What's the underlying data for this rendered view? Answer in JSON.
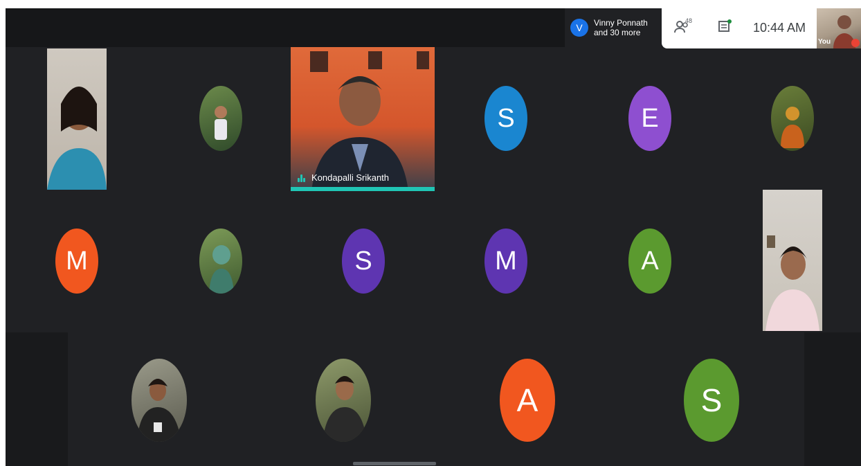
{
  "presenter": {
    "initial": "V",
    "line1": "Vinny Ponnath",
    "line2": "and 30 more"
  },
  "info": {
    "people_count": "48",
    "time": "10:44 AM"
  },
  "self": {
    "label": "You"
  },
  "speaker": {
    "name": "Kondapalli Srikanth"
  },
  "tiles": {
    "row1": {
      "s": "S",
      "e": "E"
    },
    "row2": {
      "m1": "M",
      "s": "S",
      "m2": "M",
      "a": "A"
    },
    "row3": {
      "a": "A",
      "s": "S"
    }
  },
  "colors": {
    "blue": "#1a86d0",
    "purple_light": "#8e4fd0",
    "orange": "#f1571f",
    "purple_dark": "#5e35b1",
    "green": "#5b9a2f",
    "accent_speaking": "#20c5b5"
  }
}
